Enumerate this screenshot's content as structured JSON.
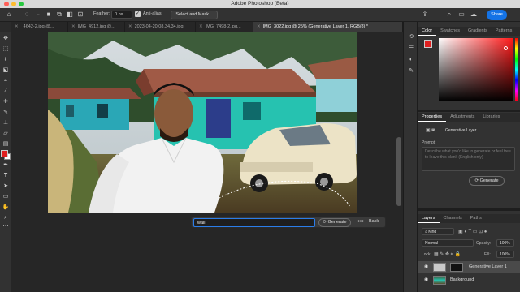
{
  "window": {
    "title": "Adobe Photoshop (Beta)"
  },
  "colors": {
    "accent": "#1473e6",
    "foreground": "#e02020",
    "background": "#ffffff"
  },
  "options_bar": {
    "feather_label": "Feather:",
    "feather_value": "0 px",
    "anti_alias_label": "Anti-alias",
    "select_mask_label": "Select and Mask...",
    "share_label": "Share"
  },
  "tabs": [
    {
      "label": "_4642-2.jpg @...",
      "active": false
    },
    {
      "label": "IMG_4912.jpg @...",
      "active": false
    },
    {
      "label": "2023-04-20 08.34.34.jpg",
      "active": false
    },
    {
      "label": "IMG_7498-2.jpg...",
      "active": false
    },
    {
      "label": "IMG_3022.jpg @ 25% (Generative Layer 1, RGB/8) *",
      "active": true
    }
  ],
  "generative_bar": {
    "input_value": "wall",
    "generate_label": "Generate",
    "more_label": "•••",
    "back_label": "Back"
  },
  "color_panel": {
    "tabs": [
      "Color",
      "Swatches",
      "Gradients",
      "Patterns"
    ]
  },
  "properties_panel": {
    "tabs": [
      "Properties",
      "Adjustments",
      "Libraries"
    ],
    "layer_type": "Generative Layer",
    "prompt_label": "Prompt:",
    "prompt_placeholder": "Describe what you'd like to generate or feel free to leave this blank (English only)",
    "generate_label": "Generate"
  },
  "layers_panel": {
    "tabs": [
      "Layers",
      "Channels",
      "Paths"
    ],
    "kind_label": "Kind",
    "blend_mode": "Normal",
    "opacity_label": "Opacity:",
    "opacity_value": "100%",
    "lock_label": "Lock:",
    "fill_label": "Fill:",
    "fill_value": "100%",
    "layers": [
      {
        "name": "Generative Layer 1",
        "selected": true
      },
      {
        "name": "Background",
        "selected": false
      }
    ]
  }
}
